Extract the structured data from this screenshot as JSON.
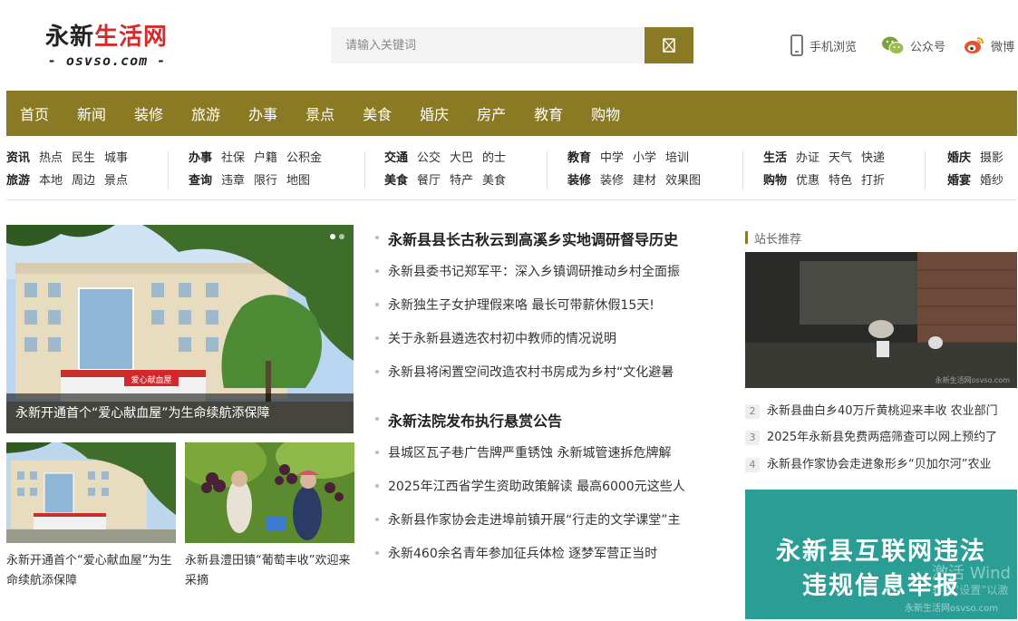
{
  "header": {
    "logo_dark": "永新",
    "logo_red": "生活网",
    "logo_domain": "- osvso.com -",
    "search_placeholder": "请输入关键词",
    "tools": [
      {
        "label": "手机浏览",
        "icon": "mobile-icon"
      },
      {
        "label": "公众号",
        "icon": "wechat-icon"
      },
      {
        "label": "微博",
        "icon": "weibo-icon"
      }
    ]
  },
  "nav": [
    "首页",
    "新闻",
    "装修",
    "旅游",
    "办事",
    "景点",
    "美食",
    "婚庆",
    "房产",
    "教育",
    "购物"
  ],
  "subnav": [
    {
      "row1": [
        "资讯",
        "热点",
        "民生",
        "城事"
      ],
      "row2": [
        "旅游",
        "本地",
        "周边",
        "景点"
      ]
    },
    {
      "row1": [
        "办事",
        "社保",
        "户籍",
        "公积金"
      ],
      "row2": [
        "查询",
        "违章",
        "限行",
        "地图"
      ]
    },
    {
      "row1": [
        "交通",
        "公交",
        "大巴",
        "的士"
      ],
      "row2": [
        "美食",
        "餐厅",
        "特产",
        "美食"
      ]
    },
    {
      "row1": [
        "教育",
        "中学",
        "小学",
        "培训"
      ],
      "row2": [
        "装修",
        "装修",
        "建材",
        "效果图"
      ]
    },
    {
      "row1": [
        "生活",
        "办证",
        "天气",
        "快递"
      ],
      "row2": [
        "购物",
        "优惠",
        "特色",
        "打折"
      ]
    },
    {
      "row1": [
        "婚庆",
        "摄影"
      ],
      "row2": [
        "婚宴",
        "婚纱"
      ]
    }
  ],
  "slideshow": {
    "caption": "永新开通首个“爱心献血屋”为生命续航添保障",
    "sign_text": "爱心献血屋"
  },
  "thumbs": [
    {
      "caption": "永新开通首个“爱心献血屋”为生命续航添保障"
    },
    {
      "caption": "永新县澧田镇“葡萄丰收”欢迎来采摘"
    }
  ],
  "news": {
    "headline1": "永新县县长古秋云到高溪乡实地调研督导历史",
    "group1": [
      "永新县委书记郑军平：深入乡镇调研推动乡村全面振",
      "永新独生子女护理假来咯 最长可带薪休假15天!",
      "关于永新县遴选农村初中教师的情况说明",
      "永新县将闲置空间改造农村书房成为乡村“文化避暑"
    ],
    "headline2": "永新法院发布执行悬赏公告",
    "group2": [
      "县城区瓦子巷广告牌严重锈蚀 永新城管速拆危牌解",
      "2025年江西省学生资助政策解读 最高6000元这些人",
      "永新县作家协会走进埠前镇开展“行走的文学课堂”主",
      "永新460余名青年参加征兵体检 逐梦军营正当时"
    ]
  },
  "sidebar": {
    "title": "站长推荐",
    "photo_watermark": "永新生活网osvso.com",
    "list": [
      {
        "num": "2",
        "text": "永新县曲白乡40万斤黄桃迎来丰收 农业部门"
      },
      {
        "num": "3",
        "text": "2025年永新县免费两癌筛查可以网上预约了"
      },
      {
        "num": "4",
        "text": "永新县作家协会走进象形乡“贝加尔河”农业"
      }
    ],
    "banner_line1": "永新县互联网违法",
    "banner_line2": "违规信息举报",
    "banner_overlay1": "激活 Wind",
    "banner_overlay2": "转到“设置”以激",
    "banner_watermark": "永新生活网osvso.com"
  },
  "colors": {
    "accent": "#8a7a23",
    "logo_red": "#d52b2b",
    "banner": "#2a9d95"
  }
}
